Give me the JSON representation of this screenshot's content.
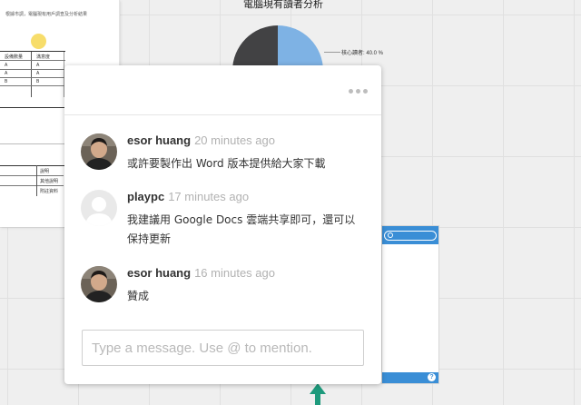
{
  "background_doc": {
    "title_text": "根據市調，電腦現有用戶調查及分析結果",
    "table1": [
      [
        "設備數量",
        "滿意度"
      ],
      [
        "A",
        "A"
      ],
      [
        "A",
        "A"
      ],
      [
        "B",
        "B"
      ]
    ],
    "table2": [
      "說明",
      "其他說明",
      "附註資料"
    ]
  },
  "chart": {
    "title": "電腦現有讀者分析",
    "slice_label": "核心讀者: 40.0 %",
    "colors": {
      "dark": "#424244",
      "light": "#7eb2e4"
    }
  },
  "comments_popup": {
    "more_icon": "ellipsis-icon",
    "comments": [
      {
        "author": "esor huang",
        "time": "20 minutes ago",
        "text": "或許要製作出 Word 版本提供給大家下載",
        "avatar": "photo"
      },
      {
        "author": "playpc",
        "time": "17 minutes ago",
        "text": "我建議用 Google Docs 雲端共享即可，還可以保持更新",
        "avatar": "default-user"
      },
      {
        "author": "esor huang",
        "time": "16 minutes ago",
        "text": "贊成",
        "avatar": "photo"
      }
    ],
    "input_placeholder": "Type a message. Use @ to mention."
  },
  "colors": {
    "accent_blue": "#3a8ed6",
    "teal_arrow": "#1d9a7c",
    "canvas_bg": "#efefef"
  }
}
